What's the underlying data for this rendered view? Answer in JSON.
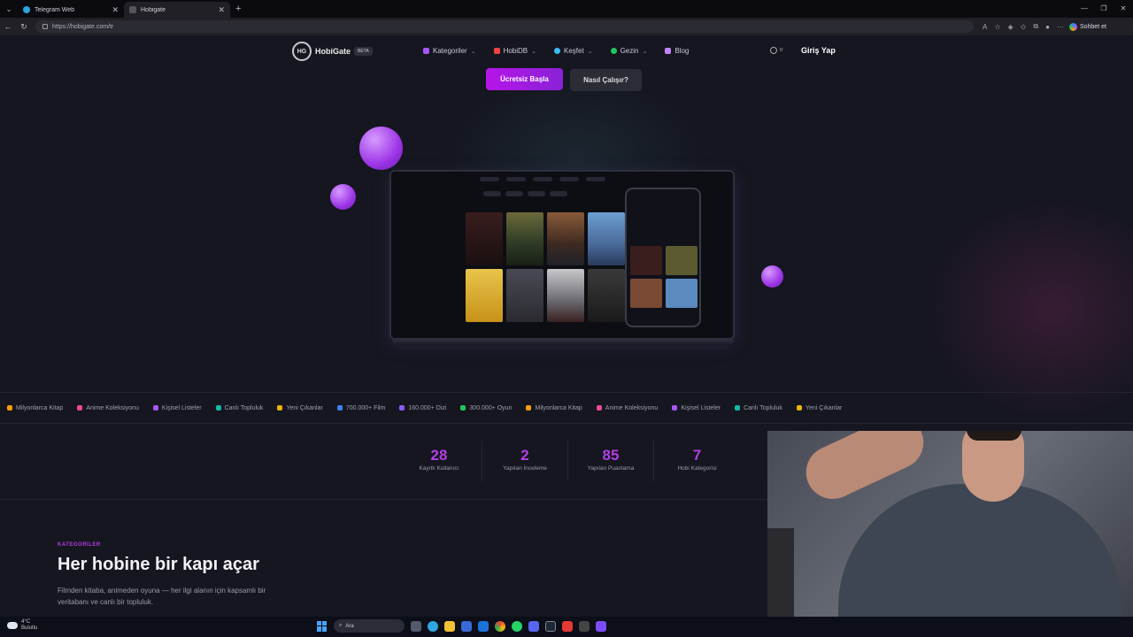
{
  "browser": {
    "tabs": [
      {
        "label": "Telegram Web",
        "active": false
      },
      {
        "label": "Hobigate",
        "active": true
      }
    ],
    "url": "https://hobigate.com/tr",
    "chat_label": "Sohbet et"
  },
  "site": {
    "logo_mark": "HG",
    "logo_text": "HobiGate",
    "beta": "BETA",
    "menu": [
      {
        "label": "Kategoriler",
        "color": "#a855f7"
      },
      {
        "label": "HobiDB",
        "color": "#ef4444"
      },
      {
        "label": "Keşfet",
        "color": "#38bdf8"
      },
      {
        "label": "Gezin",
        "color": "#22c55e"
      },
      {
        "label": "Blog",
        "color": "#c084fc"
      }
    ],
    "lang": "tr",
    "login": "Giriş Yap",
    "cta_primary": "Ücretsiz Başla",
    "cta_secondary": "Nasıl Çalışır?",
    "ticker": [
      "Milyonlarca Kitap",
      "Anime Koleksiyonu",
      "Kişisel Listeler",
      "Canlı Topluluk",
      "Yeni Çıkanlar",
      "700.000+ Film",
      "160.000+ Dizi",
      "300.000+ Oyun",
      "Milyonlarca Kitap",
      "Anime Koleksiyonu",
      "Kişisel Listeler",
      "Canlı Topluluk",
      "Yeni Çıkanlar"
    ],
    "stats": [
      {
        "value": "28",
        "label": "Kayıtlı Kullanıcı"
      },
      {
        "value": "2",
        "label": "Yapılan İnceleme"
      },
      {
        "value": "85",
        "label": "Yapılan Puanlama"
      },
      {
        "value": "7",
        "label": "Hobi Kategorisi"
      }
    ],
    "section": {
      "eyebrow": "KATEGORİLER",
      "title": "Her hobine bir kapı açar",
      "desc": "Filmden kitaba, animeden oyuna — her ilgi alanın için kapsamlı bir veritabanı ve canlı bir topluluk."
    },
    "accent": "#b43ee6"
  },
  "taskbar": {
    "temp": "4°C",
    "weather": "Bulutlu",
    "search": "Ara"
  }
}
